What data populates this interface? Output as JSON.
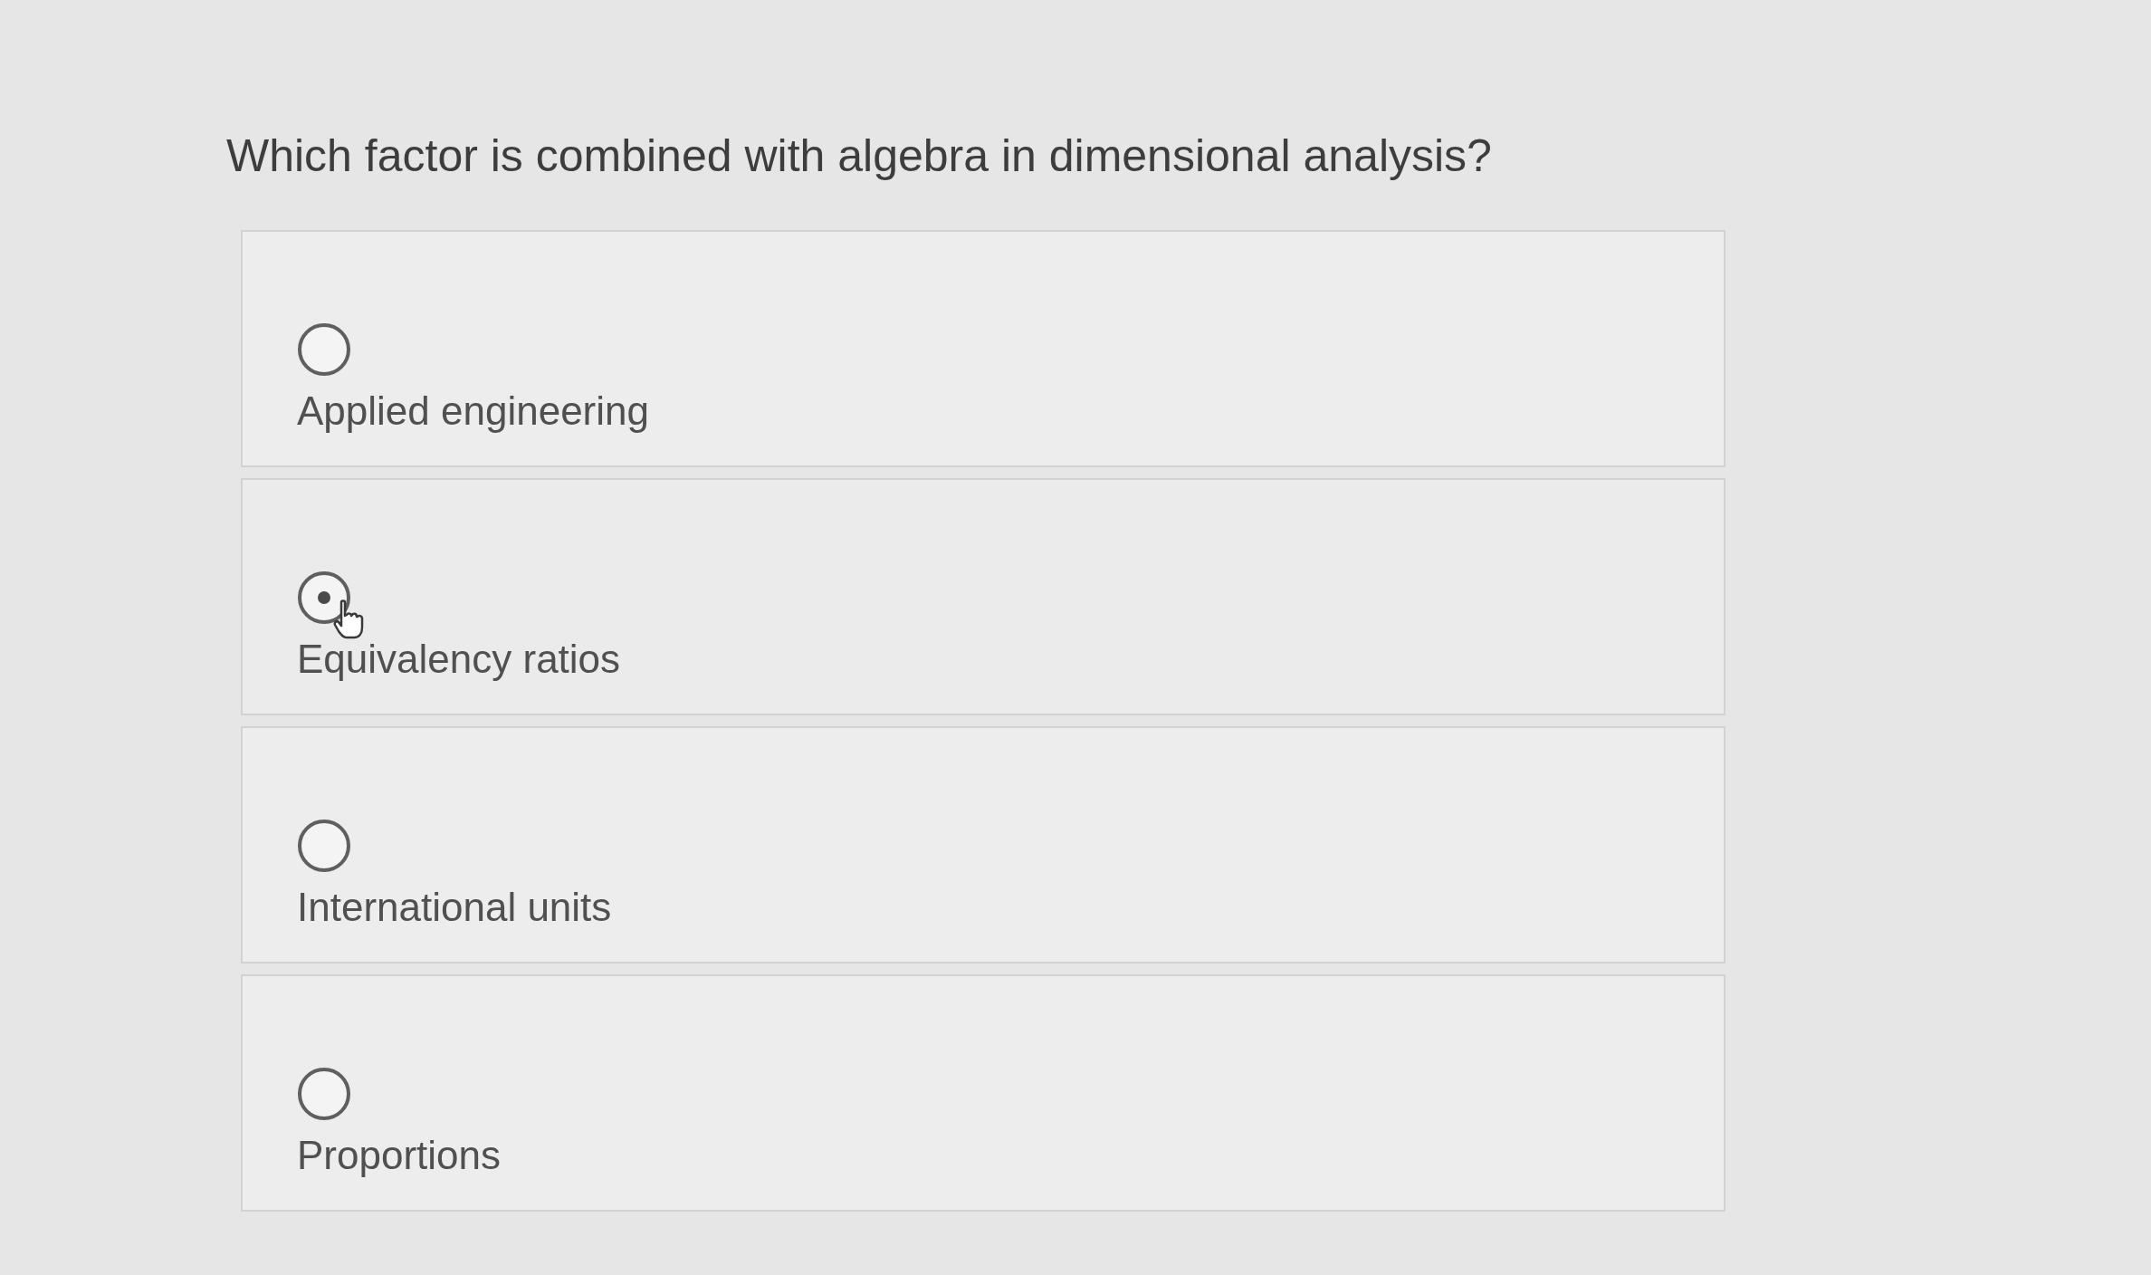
{
  "question": "Which factor is combined with algebra in dimensional analysis?",
  "options": [
    {
      "label": "Applied engineering",
      "selected": false
    },
    {
      "label": "Equivalency ratios",
      "selected": true
    },
    {
      "label": "International units",
      "selected": false
    },
    {
      "label": "Proportions",
      "selected": false
    }
  ]
}
